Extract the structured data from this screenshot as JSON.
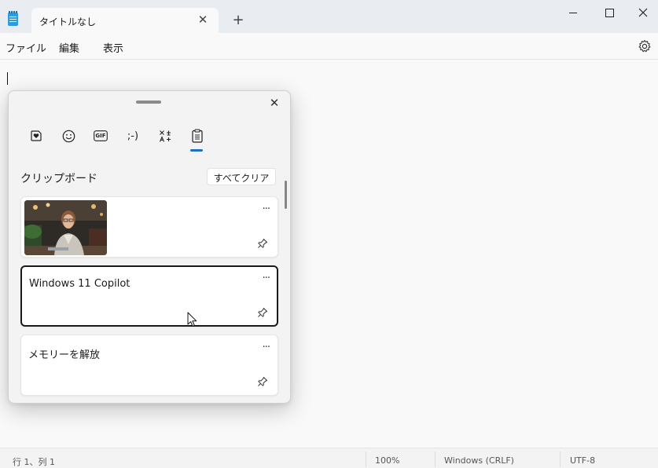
{
  "window": {
    "tab_title": "タイトルなし",
    "app_icon": "notepad-icon",
    "new_tab_glyph": "+",
    "close_glyph": "✕"
  },
  "menu": {
    "file": "ファイル",
    "edit": "編集",
    "view": "表示",
    "settings_icon": "gear-icon"
  },
  "clipboard_panel": {
    "close_glyph": "✕",
    "tabs": [
      {
        "name": "recently-used-tab",
        "icon": "heart-sticker-icon"
      },
      {
        "name": "emoji-tab",
        "icon": "smiley-icon"
      },
      {
        "name": "gif-tab",
        "label": "GIF"
      },
      {
        "name": "kaomoji-tab",
        "label": ";-)"
      },
      {
        "name": "symbols-tab",
        "icon": "symbols-icon"
      },
      {
        "name": "clipboard-tab",
        "icon": "clipboard-icon",
        "selected": true
      }
    ],
    "section_title": "クリップボード",
    "clear_all_label": "すべてクリア",
    "items": [
      {
        "type": "image",
        "description_icon": "photo-thumbnail",
        "more": "···"
      },
      {
        "type": "text",
        "text": "Windows 11 Copilot",
        "more": "···",
        "selected": true
      },
      {
        "type": "text",
        "text": "メモリーを解放",
        "more": "···"
      }
    ],
    "accent_color": "#1f6fbf"
  },
  "status": {
    "position": "行 1、列 1",
    "zoom": "100%",
    "line_ending": "Windows (CRLF)",
    "encoding": "UTF-8"
  }
}
